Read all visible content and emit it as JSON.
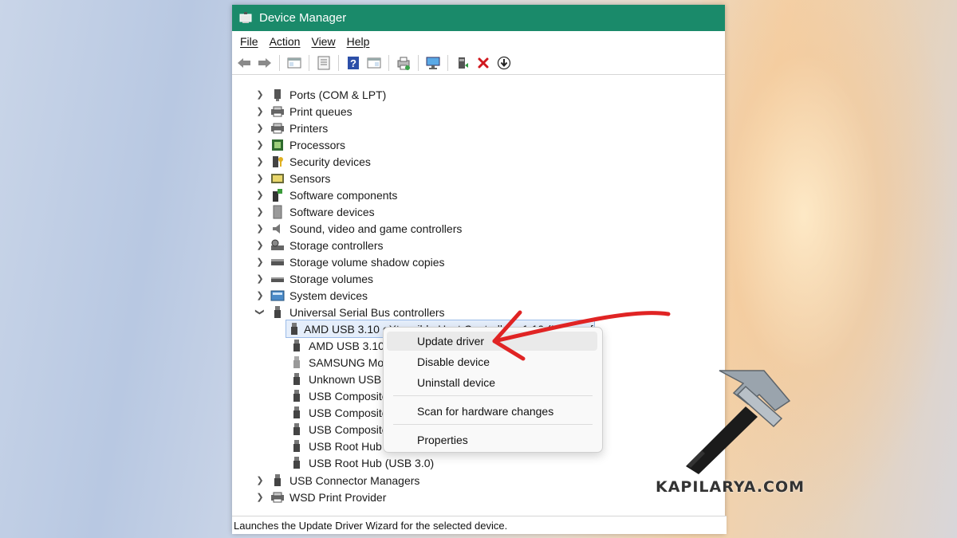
{
  "window": {
    "title": "Device Manager"
  },
  "menu": {
    "file": "File",
    "action": "Action",
    "view": "View",
    "help": "Help"
  },
  "toolbar": {
    "icons": [
      "back-arrow-icon",
      "forward-arrow-icon",
      "show-hide-tree-icon",
      "properties-icon",
      "help-icon",
      "view-icon",
      "print-icon",
      "monitor-icon",
      "update-driver-icon",
      "uninstall-x-icon",
      "download-icon"
    ]
  },
  "tree": {
    "items": [
      {
        "label": "Ports (COM & LPT)",
        "icon": "port-icon"
      },
      {
        "label": "Print queues",
        "icon": "printer-icon"
      },
      {
        "label": "Printers",
        "icon": "printer-icon"
      },
      {
        "label": "Processors",
        "icon": "chip-icon"
      },
      {
        "label": "Security devices",
        "icon": "key-icon"
      },
      {
        "label": "Sensors",
        "icon": "sensor-icon"
      },
      {
        "label": "Software components",
        "icon": "component-icon"
      },
      {
        "label": "Software devices",
        "icon": "device-icon"
      },
      {
        "label": "Sound, video and game controllers",
        "icon": "speaker-icon"
      },
      {
        "label": "Storage controllers",
        "icon": "storage-controller-icon"
      },
      {
        "label": "Storage volume shadow copies",
        "icon": "drive-icon"
      },
      {
        "label": "Storage volumes",
        "icon": "drive-icon"
      },
      {
        "label": "System devices",
        "icon": "system-icon"
      },
      {
        "label": "Universal Serial Bus controllers",
        "icon": "usb-icon"
      }
    ],
    "usb_children": [
      "AMD USB 3.10 eXtensible Host Controller - 1.10 (Microsoft)",
      "AMD USB 3.10 e",
      "SAMSUNG Mo",
      "Unknown USB",
      "USB Composite",
      "USB Composite",
      "USB Composite",
      "USB Root Hub",
      "USB Root Hub (USB 3.0)"
    ],
    "after": [
      {
        "label": "USB Connector Managers",
        "icon": "usb-icon"
      },
      {
        "label": "WSD Print Provider",
        "icon": "printer-icon"
      }
    ]
  },
  "context_menu": {
    "update": "Update driver",
    "disable": "Disable device",
    "uninstall": "Uninstall device",
    "scan": "Scan for hardware changes",
    "properties": "Properties"
  },
  "status": {
    "text": "Launches the Update Driver Wizard for the selected device."
  },
  "watermark": "KAPILARYA.COM",
  "colors": {
    "titlebar": "#1a8a6a",
    "arrow": "#e02424"
  }
}
